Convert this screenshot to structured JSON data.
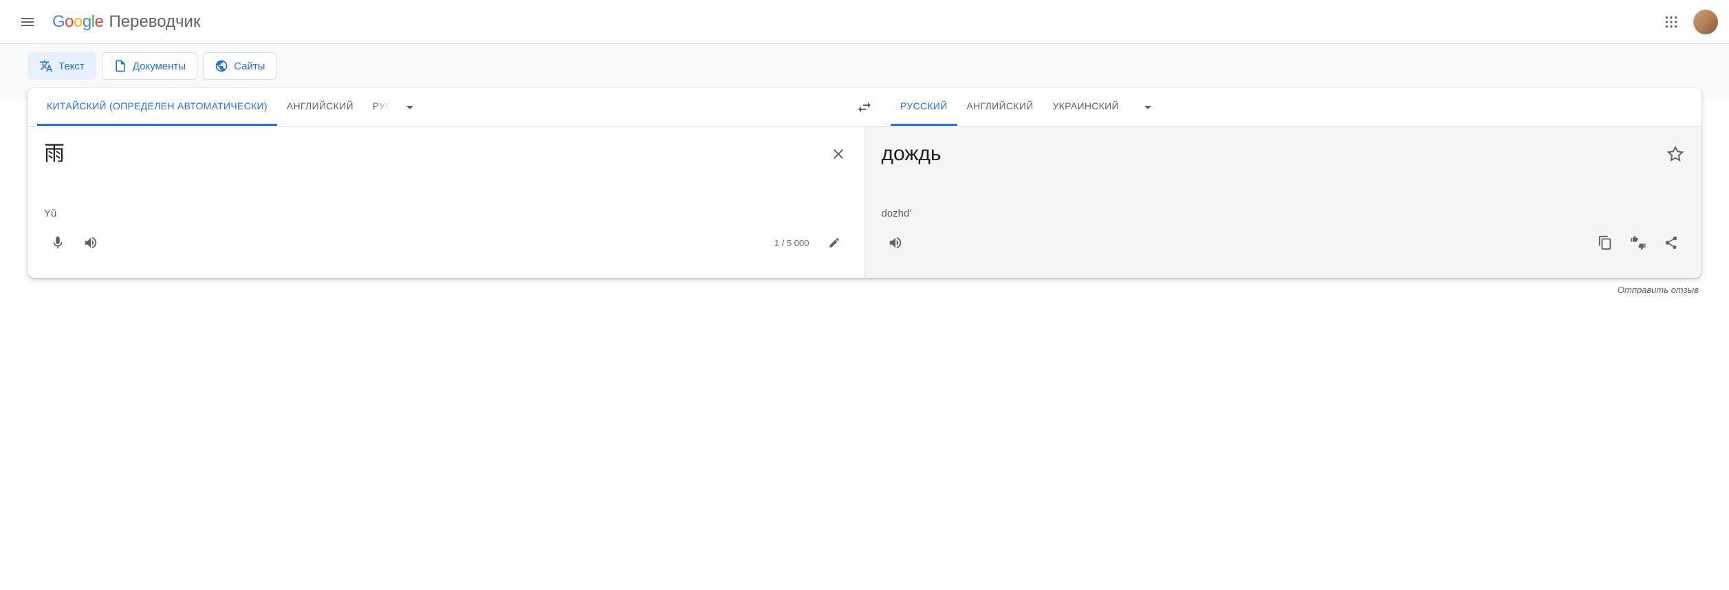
{
  "header": {
    "product_name": "Переводчик"
  },
  "modes": {
    "text": "Текст",
    "documents": "Документы",
    "sites": "Сайты"
  },
  "source_langs": {
    "detected": "КИТАЙСКИЙ (ОПРЕДЕЛЕН АВТОМАТИЧЕСКИ)",
    "english": "АНГЛИЙСКИЙ",
    "russian_truncated": "РУССКИЙ"
  },
  "target_langs": {
    "russian": "РУССКИЙ",
    "english": "АНГЛИЙСКИЙ",
    "ukrainian": "УКРАИНСКИЙ"
  },
  "source": {
    "text": "雨",
    "transliteration": "Yǔ",
    "char_count": "1 / 5 000"
  },
  "target": {
    "text": "дождь",
    "transliteration": "dozhd'"
  },
  "feedback_link": "Отправить отзыв"
}
